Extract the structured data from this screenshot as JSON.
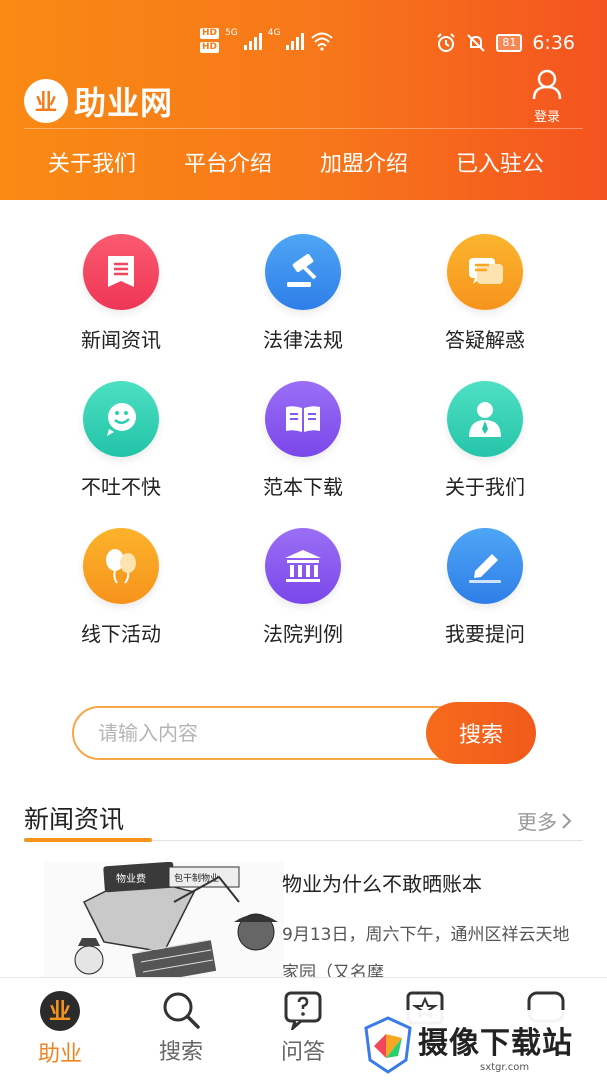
{
  "status_bar": {
    "hd1": "HD",
    "hd2": "HD",
    "net1": "5G",
    "net2": "4G",
    "battery": "81",
    "time": "6:36"
  },
  "header": {
    "logo_text": "助业网",
    "logo_badge": "业",
    "login_label": "登录"
  },
  "top_nav": [
    "关于我们",
    "平台介绍",
    "加盟介绍",
    "已入驻公"
  ],
  "grid": [
    {
      "label": "新闻资讯",
      "icon": "news-icon",
      "color": "#f2465f"
    },
    {
      "label": "法律法规",
      "icon": "gavel-icon",
      "color": "#3d8ef0"
    },
    {
      "label": "答疑解惑",
      "icon": "chat-icon",
      "color": "#f9a623"
    },
    {
      "label": "不吐不快",
      "icon": "smile-icon",
      "color": "#2ccfb4"
    },
    {
      "label": "范本下载",
      "icon": "book-icon",
      "color": "#8758f0"
    },
    {
      "label": "关于我们",
      "icon": "person-icon",
      "color": "#32cfb5"
    },
    {
      "label": "线下活动",
      "icon": "balloon-icon",
      "color": "#f9a41f"
    },
    {
      "label": "法院判例",
      "icon": "court-icon",
      "color": "#8a55ef"
    },
    {
      "label": "我要提问",
      "icon": "pencil-icon",
      "color": "#3f8ef1"
    }
  ],
  "search": {
    "placeholder": "请输入内容",
    "button": "搜索"
  },
  "news_section": {
    "title": "新闻资讯",
    "more": "更多",
    "item": {
      "title": "物业为什么不敢晒账本",
      "snippet": "9月13日，周六下午，通州区祥云天地家园（又名摩",
      "img_text1": "物业费",
      "img_text2": "包干制物业"
    }
  },
  "tabbar": [
    {
      "label": "助业",
      "icon": "home-logo-icon",
      "active": true
    },
    {
      "label": "搜索",
      "icon": "search-icon",
      "active": false
    },
    {
      "label": "问答",
      "icon": "question-icon",
      "active": false
    },
    {
      "label": "",
      "icon": "star-icon",
      "active": false
    },
    {
      "label": "",
      "icon": "message-icon",
      "active": false
    }
  ],
  "watermark": {
    "text": "摄像下载站",
    "sub": "sxtgr.com"
  },
  "colors": {
    "brand": "#f7761a",
    "accent": "#f7941d"
  }
}
